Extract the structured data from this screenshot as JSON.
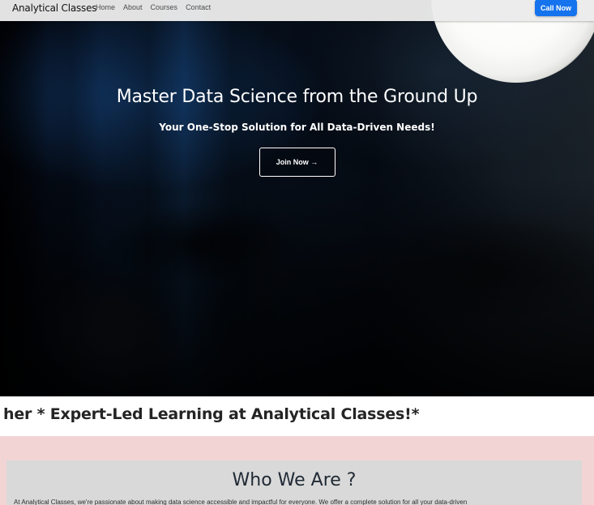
{
  "navbar": {
    "brand": "Analytical Classes",
    "links": [
      "Home",
      "About",
      "Courses",
      "Contact"
    ],
    "call_label": "Call Now"
  },
  "hero": {
    "title": "Master Data Science from the Ground Up",
    "subtitle": "Your One-Stop Solution for All Data-Driven Needs!",
    "join_label": "Join Now →"
  },
  "ticker": {
    "text": "her * Expert-Led Learning at Analytical Classes!*"
  },
  "about": {
    "title": "Who We Are ?",
    "text": "At Analytical Classes, we're passionate about making data science accessible and impactful for everyone. We offer a complete solution for all your data-driven"
  },
  "colors": {
    "call_button": "#1573ee",
    "section_background": "#f3d4d4",
    "card_background": "#d9d9d9"
  }
}
